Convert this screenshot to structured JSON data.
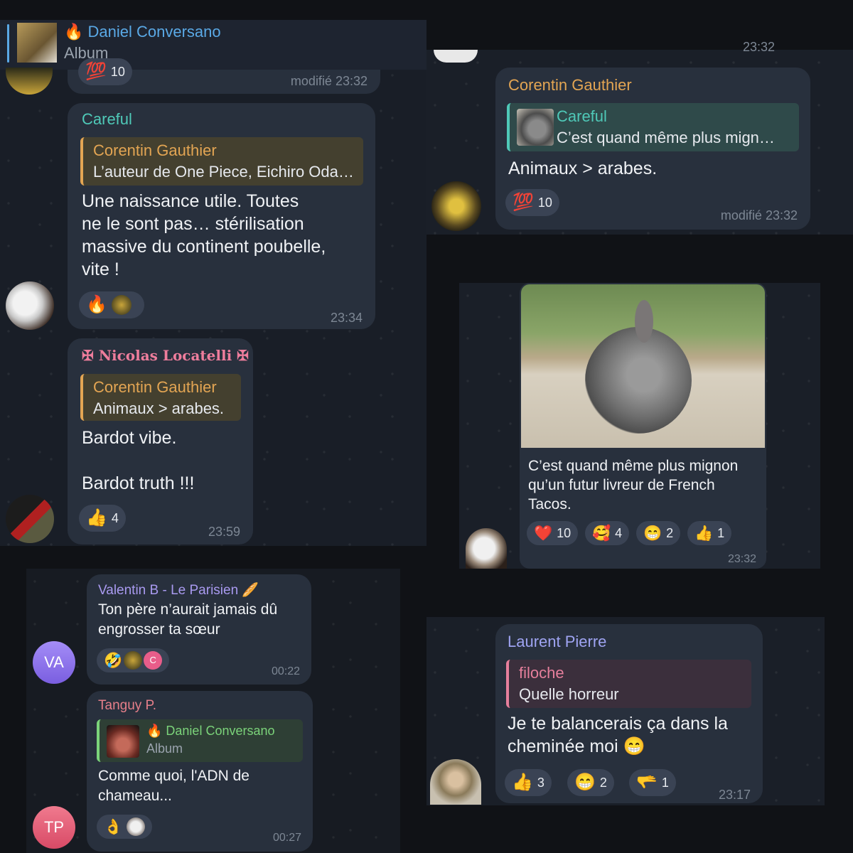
{
  "pinned": {
    "name": "🔥 Daniel Conversano",
    "subtitle": "Album",
    "count": "10",
    "edited": "modifié 23:32"
  },
  "msg_careful": {
    "sender": "Careful",
    "reply_name": "Corentin Gauthier",
    "reply_text": "L’auteur de One Piece, Eichiro Oda…",
    "lines": [
      "Une naissance utile. Toutes",
      "ne le sont pas… stérilisation",
      "massive du continent poubelle,",
      "vite !"
    ],
    "reaction_emoji": "🔥",
    "time": "23:34"
  },
  "msg_nicolas": {
    "sender": "✠ Nicolas Locatelli ✠",
    "reply_name": "Corentin Gauthier",
    "reply_text": "Animaux > arabes.",
    "line1": "Bardot vibe.",
    "line2": "Bardot truth !!!",
    "reaction_emoji": "👍",
    "reaction_count": "4",
    "time": "23:59"
  },
  "msg_corentin": {
    "top_time": "23:32",
    "sender": "Corentin Gauthier",
    "reply_name": "Careful",
    "reply_text": "C’est quand même plus mign…",
    "text": "Animaux > arabes.",
    "reaction_emoji": "💯",
    "reaction_count": "10",
    "edited": "modifié 23:32"
  },
  "msg_photo": {
    "caption": [
      "C’est quand même plus mignon",
      "qu’un futur livreur de French",
      "Tacos."
    ],
    "reactions": [
      {
        "emoji": "❤️",
        "count": "10"
      },
      {
        "emoji": "🥰",
        "count": "4"
      },
      {
        "emoji": "😁",
        "count": "2"
      },
      {
        "emoji": "👍",
        "count": "1"
      }
    ],
    "time": "23:32"
  },
  "msg_valentin": {
    "avatar": "VA",
    "sender": "Valentin B - Le Parisien 🥖",
    "lines": [
      "Ton père n’aurait jamais dû",
      "engrosser ta sœur"
    ],
    "reaction_emoji": "🤣",
    "mini_letter": "C",
    "time": "00:22"
  },
  "msg_tanguy": {
    "avatar": "TP",
    "sender": "Tanguy P.",
    "reply_name": "🔥 Daniel Conversano",
    "reply_text": "Album",
    "lines": [
      "Comme quoi, l'ADN de",
      "chameau..."
    ],
    "reaction_emoji": "👌",
    "time": "00:27"
  },
  "msg_laurent": {
    "sender": "Laurent Pierre",
    "reply_name": "filoche",
    "reply_text": "Quelle horreur",
    "lines": [
      "Je te balancerais ça dans la",
      "cheminée moi 😁"
    ],
    "reactions": [
      {
        "emoji": "👍",
        "count": "3"
      },
      {
        "emoji": "😁",
        "count": "2"
      },
      {
        "emoji": "🫳",
        "count": "1"
      }
    ],
    "time": "23:17"
  },
  "colors": {
    "careful": "#4fc9b8",
    "corentin": "#e3a553",
    "nicolas": "#ee7d9c",
    "valentin": "#a99af0",
    "tanguy": "#e67f8a",
    "green": "#7bd37a",
    "filoche": "#e67f9c",
    "laurent": "#9fa4f2"
  }
}
